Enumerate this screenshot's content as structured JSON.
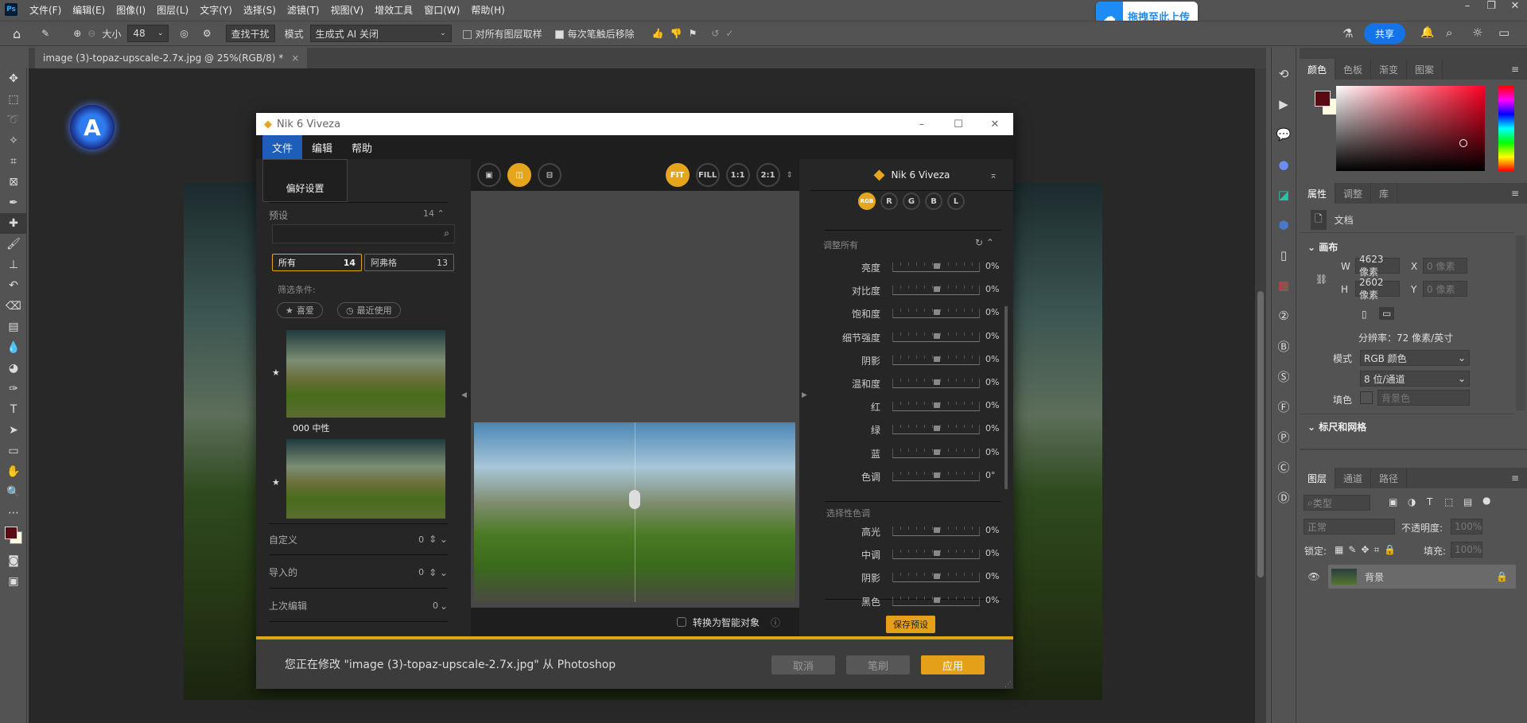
{
  "app": {
    "logo": "Ps",
    "menus": [
      "文件(F)",
      "编辑(E)",
      "图像(I)",
      "图层(L)",
      "文字(Y)",
      "选择(S)",
      "滤镜(T)",
      "视图(V)",
      "增效工具",
      "窗口(W)",
      "帮助(H)"
    ]
  },
  "options": {
    "size_label": "大小",
    "size_value": "48",
    "find_label": "查找干扰",
    "mode_label": "模式",
    "mode_value": "生成式 AI 关闭",
    "sample_all": "对所有图层取样",
    "sample_all_checked": false,
    "remove_after": "每次笔触后移除",
    "remove_after_checked": true
  },
  "upload_badge": "拖拽至此上传",
  "share_label": "共享",
  "document_tab": {
    "title": "image (3)-topaz-upscale-2.7x.jpg @ 25%(RGB/8) *",
    "close": "×"
  },
  "color_panel": {
    "tabs": [
      "颜色",
      "色板",
      "渐变",
      "图案"
    ],
    "foreground": "#5a0a12",
    "background": "#fffbe0"
  },
  "properties_panel": {
    "tabs": [
      "属性",
      "调整",
      "库"
    ],
    "doc_label": "文档",
    "canvas_heading": "画布",
    "w_label": "W",
    "w_value": "4623 像素",
    "h_label": "H",
    "h_value": "2602 像素",
    "x_label": "X",
    "x_value": "0 像素",
    "y_label": "Y",
    "y_value": "0 像素",
    "resolution": "分辨率：72 像素/英寸",
    "mode_label": "模式",
    "mode_value": "RGB 颜色",
    "depth_value": "8 位/通道",
    "fill_label": "填色",
    "fill_value": "背景色",
    "rulers_heading": "标尺和网格"
  },
  "layers_panel": {
    "tabs": [
      "图层",
      "通道",
      "路径"
    ],
    "filter_placeholder": "类型",
    "blend_mode": "正常",
    "opacity_label": "不透明度:",
    "opacity_value": "100%",
    "lock_label": "锁定:",
    "fill_label": "填充:",
    "fill_value": "100%",
    "layers": [
      {
        "name": "背景",
        "visible": true,
        "locked": true
      }
    ]
  },
  "nik": {
    "title": "Nik 6 Viveza",
    "menu": [
      "文件",
      "编辑",
      "帮助"
    ],
    "dropdown_item": "偏好设置",
    "presets": {
      "label": "预设",
      "count": "14",
      "search_placeholder": "",
      "filter_all": "所有",
      "filter_all_count": "14",
      "filter_afg": "阿弗格",
      "filter_afg_count": "13",
      "filter_label": "筛选条件:",
      "favorites": "喜爱",
      "recent": "最近使用",
      "thumb1_name": "000 中性"
    },
    "sections": [
      {
        "label": "自定义",
        "count": "0"
      },
      {
        "label": "导入的",
        "count": "0"
      },
      {
        "label": "上次编辑",
        "count": "0"
      }
    ],
    "view_buttons": [
      "FIT",
      "FILL",
      "1:1",
      "2:1"
    ],
    "active_view": "FIT",
    "smart_object_label": "转换为智能对象",
    "smart_object_checked": false,
    "brand": "Nik 6 Viveza",
    "channels": [
      "RGB",
      "R",
      "G",
      "B",
      "L"
    ],
    "active_channel": "RGB",
    "adjust_all_label": "调整所有",
    "adjust_all": [
      {
        "label": "亮度",
        "value": "0%"
      },
      {
        "label": "对比度",
        "value": "0%"
      },
      {
        "label": "饱和度",
        "value": "0%"
      },
      {
        "label": "细节强度",
        "value": "0%"
      },
      {
        "label": "阴影",
        "value": "0%"
      },
      {
        "label": "温和度",
        "value": "0%"
      },
      {
        "label": "红",
        "value": "0%"
      },
      {
        "label": "绿",
        "value": "0%"
      },
      {
        "label": "蓝",
        "value": "0%"
      },
      {
        "label": "色调",
        "value": "0°"
      }
    ],
    "selective_label": "选择性色调",
    "selective": [
      {
        "label": "高光",
        "value": "0%"
      },
      {
        "label": "中调",
        "value": "0%"
      },
      {
        "label": "阴影",
        "value": "0%"
      },
      {
        "label": "黑色",
        "value": "0%"
      }
    ],
    "save_preset": "保存预设",
    "footer_text": "您正在修改 \"image (3)-topaz-upscale-2.7x.jpg\" 从 Photoshop",
    "cancel": "取消",
    "brush": "笔刷",
    "apply": "应用",
    "accent": "#e5a51d"
  }
}
